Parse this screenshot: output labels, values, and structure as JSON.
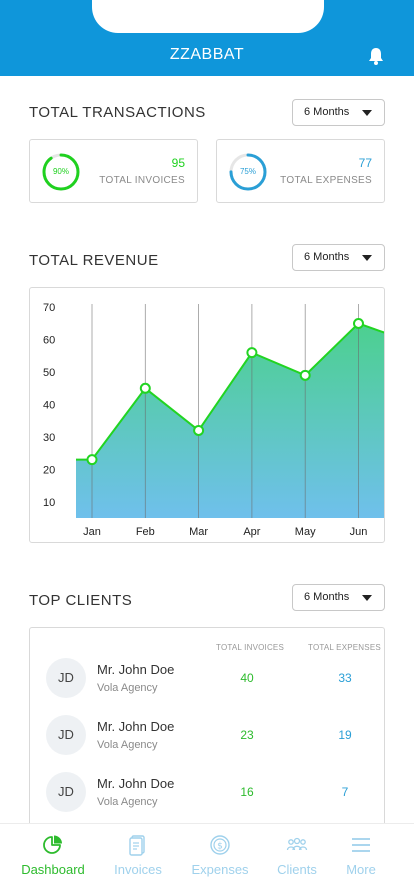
{
  "app": {
    "title": "ZZABBAT"
  },
  "transactions": {
    "title": "TOTAL TRANSACTIONS",
    "period": "6 Months",
    "invoices": {
      "percent_label": "90%",
      "percent": 90,
      "value": "95",
      "label": "TOTAL INVOICES",
      "color": "#1fd11f"
    },
    "expenses": {
      "percent_label": "75%",
      "percent": 75,
      "value": "77",
      "label": "TOTAL EXPENSES",
      "color": "#2a9fd6"
    }
  },
  "revenue": {
    "title": "TOTAL REVENUE",
    "period": "6 Months"
  },
  "chart_data": {
    "type": "area",
    "categories": [
      "Jan",
      "Feb",
      "Mar",
      "Apr",
      "May",
      "Jun"
    ],
    "values": [
      23,
      45,
      32,
      56,
      49,
      65
    ],
    "start_value": 23,
    "end_value": 62,
    "y_ticks": [
      10,
      20,
      30,
      40,
      50,
      60,
      70
    ],
    "ylim": [
      5,
      71
    ],
    "grid": "vertical",
    "colors": {
      "line": "#22d422",
      "fill_top": "#4cd08f",
      "fill_bottom": "#6fc0ec"
    }
  },
  "top_clients": {
    "title": "TOP CLIENTS",
    "period": "6 Months",
    "columns": {
      "invoices": "TOTAL INVOICES",
      "expenses": "TOTAL EXPENSES"
    },
    "rows": [
      {
        "initials": "JD",
        "name": "Mr. John Doe",
        "company": "Vola Agency",
        "invoices": "40",
        "expenses": "33"
      },
      {
        "initials": "JD",
        "name": "Mr. John Doe",
        "company": "Vola Agency",
        "invoices": "23",
        "expenses": "19"
      },
      {
        "initials": "JD",
        "name": "Mr. John Doe",
        "company": "Vola Agency",
        "invoices": "16",
        "expenses": "7"
      }
    ]
  },
  "nav": {
    "items": [
      {
        "label": "Dashboard",
        "icon": "pie-chart-icon",
        "active": true
      },
      {
        "label": "Invoices",
        "icon": "invoice-icon",
        "active": false
      },
      {
        "label": "Expenses",
        "icon": "coins-icon",
        "active": false
      },
      {
        "label": "Clients",
        "icon": "users-icon",
        "active": false
      },
      {
        "label": "More",
        "icon": "menu-icon",
        "active": false
      }
    ],
    "active_color": "#2dbb2d",
    "inactive_color": "#9fd1ec"
  },
  "colors": {
    "brand": "#0f96da"
  }
}
